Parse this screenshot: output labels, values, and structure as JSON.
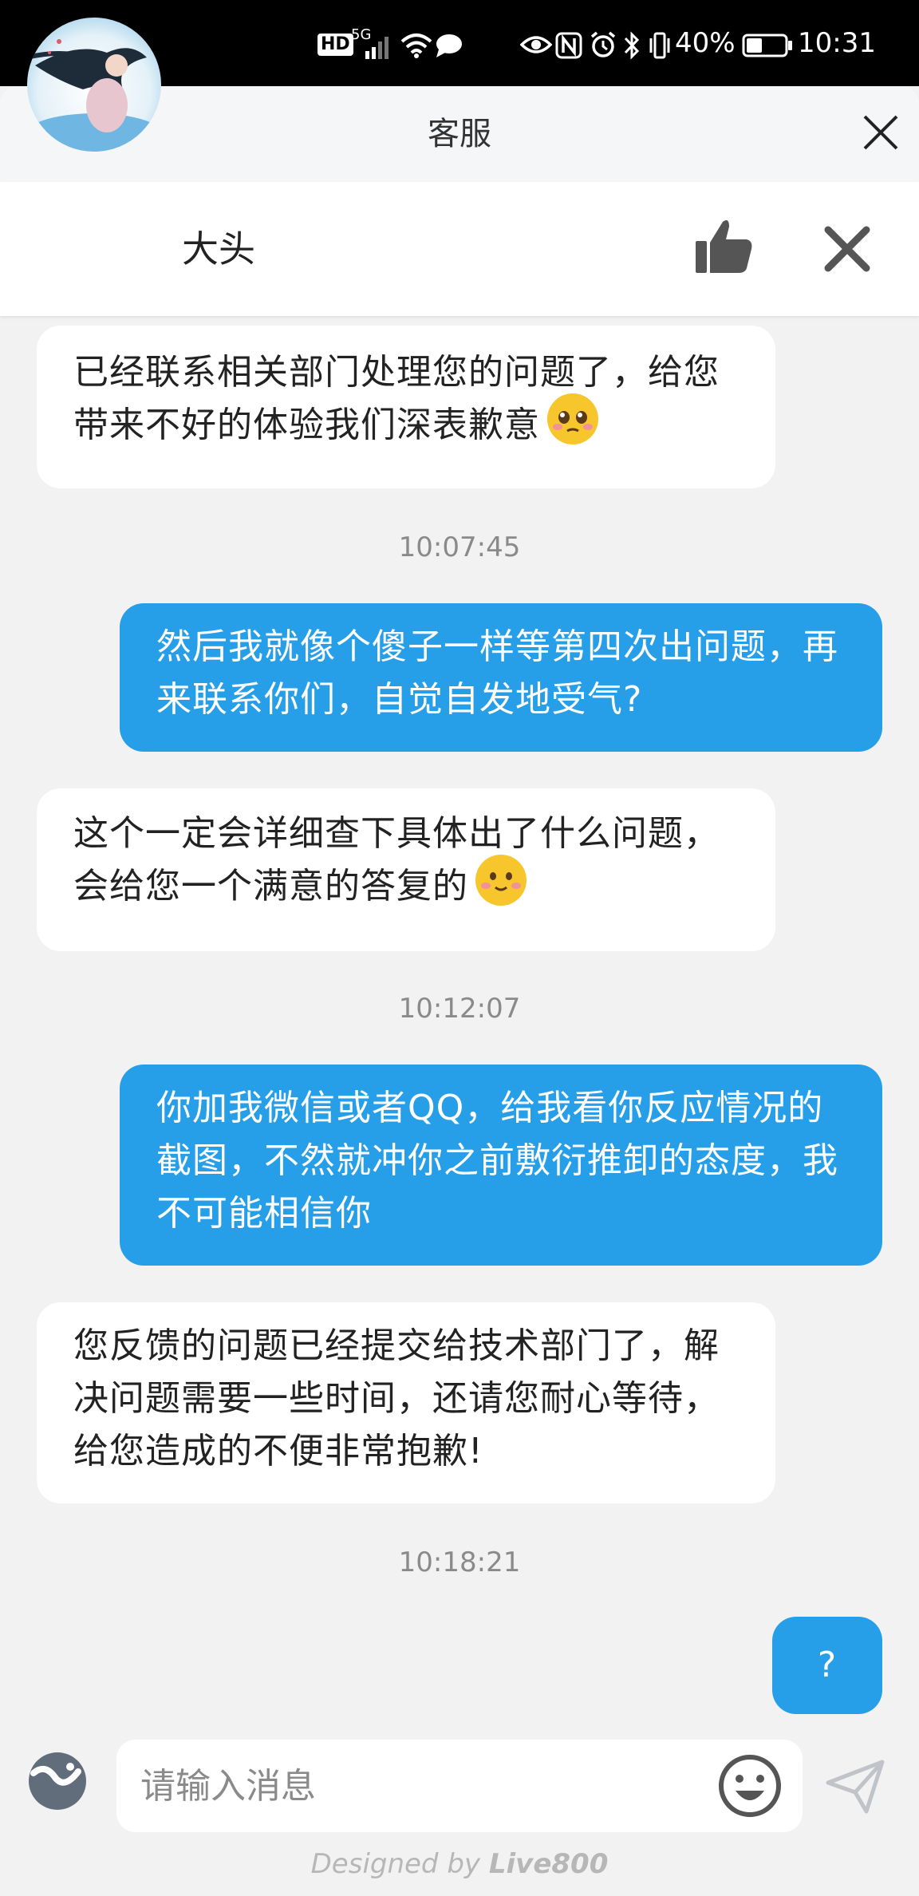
{
  "status_bar": {
    "hd": "HD",
    "network": "5G",
    "battery": "40%",
    "time": "10:31"
  },
  "header": {
    "title": "客服"
  },
  "agent": {
    "name": "大头"
  },
  "messages": [
    {
      "side": "left",
      "text": "已经联系相关部门处理您的问题了，给您带来不好的体验我们深表歉意",
      "emoji": "pleading-face"
    },
    {
      "type": "timestamp",
      "text": "10:07:45"
    },
    {
      "side": "right",
      "text": "然后我就像个傻子一样等第四次出问题，再来联系你们，自觉自发地受气?"
    },
    {
      "side": "left",
      "text": "这个一定会详细查下具体出了什么问题，会给您一个满意的答复的",
      "emoji": "smiling-face"
    },
    {
      "type": "timestamp",
      "text": "10:12:07"
    },
    {
      "side": "right",
      "text": "你加我微信或者QQ，给我看你反应情况的截图，不然就冲你之前敷衍推卸的态度，我不可能相信你"
    },
    {
      "side": "left",
      "text": "您反馈的问题已经提交给技术部门了，解决问题需要一些时间，还请您耐心等待，给您造成的不便非常抱歉!"
    },
    {
      "type": "timestamp",
      "text": "10:18:21"
    },
    {
      "side": "right",
      "text": "?"
    }
  ],
  "input": {
    "placeholder": "请输入消息"
  },
  "footer": {
    "designed_by": "Designed by",
    "brand": "Live800"
  },
  "colors": {
    "user_bubble": "#279ee8",
    "agent_bubble": "#ffffff",
    "background": "#f2f2f2"
  }
}
